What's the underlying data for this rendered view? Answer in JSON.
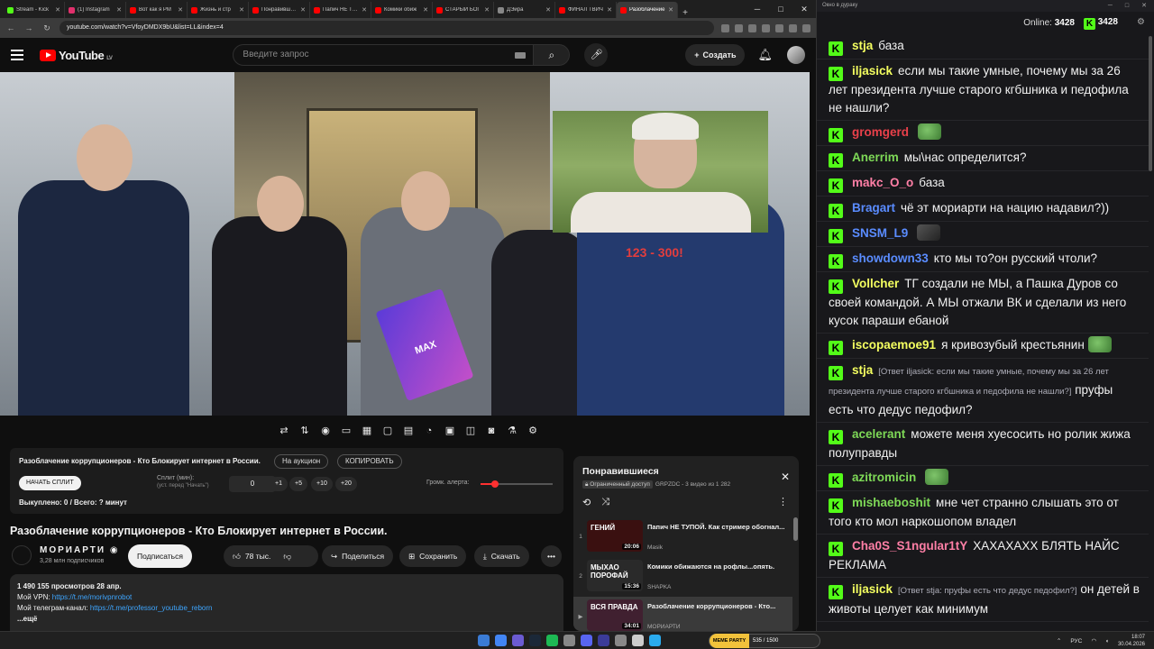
{
  "browser": {
    "tabs": [
      {
        "label": "Stream - Kick",
        "color": "#53fc18"
      },
      {
        "label": "(1) Instagram",
        "color": "#e1306c"
      },
      {
        "label": "Вот как я РМ",
        "color": "#ff0000"
      },
      {
        "label": "Жизнь и стр",
        "color": "#ff0000"
      },
      {
        "label": "Понравившиеся",
        "color": "#ff0000"
      },
      {
        "label": "Папич НЕ ТУП",
        "color": "#ff0000"
      },
      {
        "label": "Комики обиж",
        "color": "#ff0000"
      },
      {
        "label": "СТАРЫЙ БОГ",
        "color": "#ff0000"
      },
      {
        "label": "ДЭйра",
        "color": "#888888"
      },
      {
        "label": "ФИНАЛ ТВИЧ",
        "color": "#ff0000"
      },
      {
        "label": "Разоблачение",
        "color": "#ff0000",
        "active": true
      }
    ],
    "url": "youtube.com/watch?v=VfoyDMDX9bU&list=LL&index=4"
  },
  "youtube": {
    "logo_text": "YouTube",
    "region": "LV",
    "search_placeholder": "Введите запрос",
    "create_label": "Создать"
  },
  "video": {
    "card_label": "MAX",
    "overlay_text": "123 - 300!"
  },
  "extension": {
    "title": "Разоблачение коррупционеров - Кто Блокирует интернет в России.",
    "auction_label": "На аукцион",
    "copy_label": "КОПИРОВАТЬ",
    "start_split_label": "НАЧАТЬ СПЛИТ",
    "split_label": "Сплит (мин):",
    "split_hint": "(уст. перед \"Начать\")",
    "split_value": "0",
    "chips": [
      "+1",
      "+5",
      "+10",
      "+20"
    ],
    "volume_label": "Громк. алерта:",
    "volume_level": 0.2,
    "status": "Выкуплено: 0 / Всего: ? минут"
  },
  "video_info": {
    "title": "Разоблачение коррупционеров - Кто Блокирует интернет в России.",
    "channel": "МОРИАРТИ",
    "subscribers": "3,28 млн подписчиков",
    "subscribe_label": "Подписаться",
    "likes": "78 тыс.",
    "share_label": "Поделиться",
    "save_label": "Сохранить",
    "download_label": "Скачать",
    "views_date": "1 490 155 просмотров  28 апр.",
    "vpn_label": "Мой VPN: ",
    "vpn_link": "https://t.me/morivpnrobot",
    "tg_label": "Мой телеграм-канал: ",
    "tg_link": "https://t.me/professor_youtube_reborn",
    "more_label": "...ещё"
  },
  "playlist": {
    "title": "Понравившиеся",
    "access": "Ограниченный доступ",
    "meta": "GRPZDC - 3 видео из 1 282",
    "items": [
      {
        "index": "1",
        "title": "Папич НЕ ТУПОЙ. Как стример обогнал...",
        "channel": "Masik",
        "duration": "20:06",
        "thumb_text": "ГЕНИЙ",
        "thumb_color": "#3a1010"
      },
      {
        "index": "2",
        "title": "Комики обижаются на рофлы...опять.",
        "channel": "SHAPKA",
        "duration": "15:36",
        "thumb_text": "МЫХАО ПОРОФАЙ",
        "thumb_color": "#2a2a2a"
      },
      {
        "index": "▶",
        "title": "Разоблачение коррупционеров - Кто...",
        "channel": "МОРИАРТИ",
        "duration": "34:01",
        "thumb_text": "ВСЯ ПРАВДА",
        "thumb_color": "#402030"
      }
    ]
  },
  "chat": {
    "window_title": "Окно в дураку",
    "online_label": "Online:",
    "online_count": "3428",
    "kick_count": "3428",
    "messages": [
      {
        "user": "stja",
        "color": "#f4ff60",
        "text": "база"
      },
      {
        "user": "iljasick",
        "color": "#f4ff60",
        "text": "если мы такие умные, почему мы за 26 лет президента лучше старого кгбшника и педофила не нашли?"
      },
      {
        "user": "gromgerd",
        "color": "#e8404a",
        "text": "",
        "emote": "pepe"
      },
      {
        "user": "Anerrim",
        "color": "#7ed957",
        "text": "мы\\нас определится?"
      },
      {
        "user": "makc_O_o",
        "color": "#ff7fa6",
        "text": "база"
      },
      {
        "user": "Bragart",
        "color": "#5a8cff",
        "text": "чё эт мориарти на нацию надавил?))"
      },
      {
        "user": "SNSM_L9",
        "color": "#5a8cff",
        "text": "",
        "emote": "dark"
      },
      {
        "user": "showdown33",
        "color": "#5a8cff",
        "text": "кто мы то?он русский чтоли?"
      },
      {
        "user": "Vollcher",
        "color": "#f4ff60",
        "text": "ТГ создали не МЫ, а Пашка Дуров со своей командой. А МЫ отжали ВК и сделали из него кусок параши ебаной"
      },
      {
        "user": "iscopaemoe91",
        "color": "#f4ff60",
        "text": "я кривозубый крестьянин",
        "emote": "pepe"
      },
      {
        "user": "stja",
        "color": "#f4ff60",
        "reply": "[Ответ iljasick: если мы такие умные, почему мы за 26 лет президента лучше старого кгбшника и педофила не нашли?]",
        "text": "пруфы есть что дедус педофил?"
      },
      {
        "user": "acelerant",
        "color": "#7ed957",
        "text": "можете меня хуесосить но ролик жижа полуправды"
      },
      {
        "user": "azitromicin",
        "color": "#7ed957",
        "text": "",
        "emote": "pepe"
      },
      {
        "user": "mishaeboshit",
        "color": "#7ed957",
        "text": "мне чет странно слышать это от того кто мол наркошопом владел"
      },
      {
        "user": "Cha0S_S1ngular1tY",
        "color": "#ff7fa6",
        "text": "ХАХАХАХХ БЛЯТЬ НАЙС РЕКЛАМА"
      },
      {
        "user": "iljasick",
        "color": "#f4ff60",
        "reply": "[Ответ stja: пруфы есть что дедус педофил?]",
        "text": "он детей в животы целует как минимум"
      }
    ]
  },
  "taskbar": {
    "meme_party_label": "MEME PARTY",
    "meme_party_value": "535 / 1500",
    "lang": "РУС",
    "time": "18:07",
    "date": "30.04.2026",
    "icons": [
      "#3a7bd5",
      "#4285f4",
      "#6b5bd2",
      "#1b2838",
      "#1db954",
      "#888888",
      "#5865f2",
      "#3b3b98",
      "#888888",
      "#cccccc",
      "#2aabee"
    ]
  }
}
